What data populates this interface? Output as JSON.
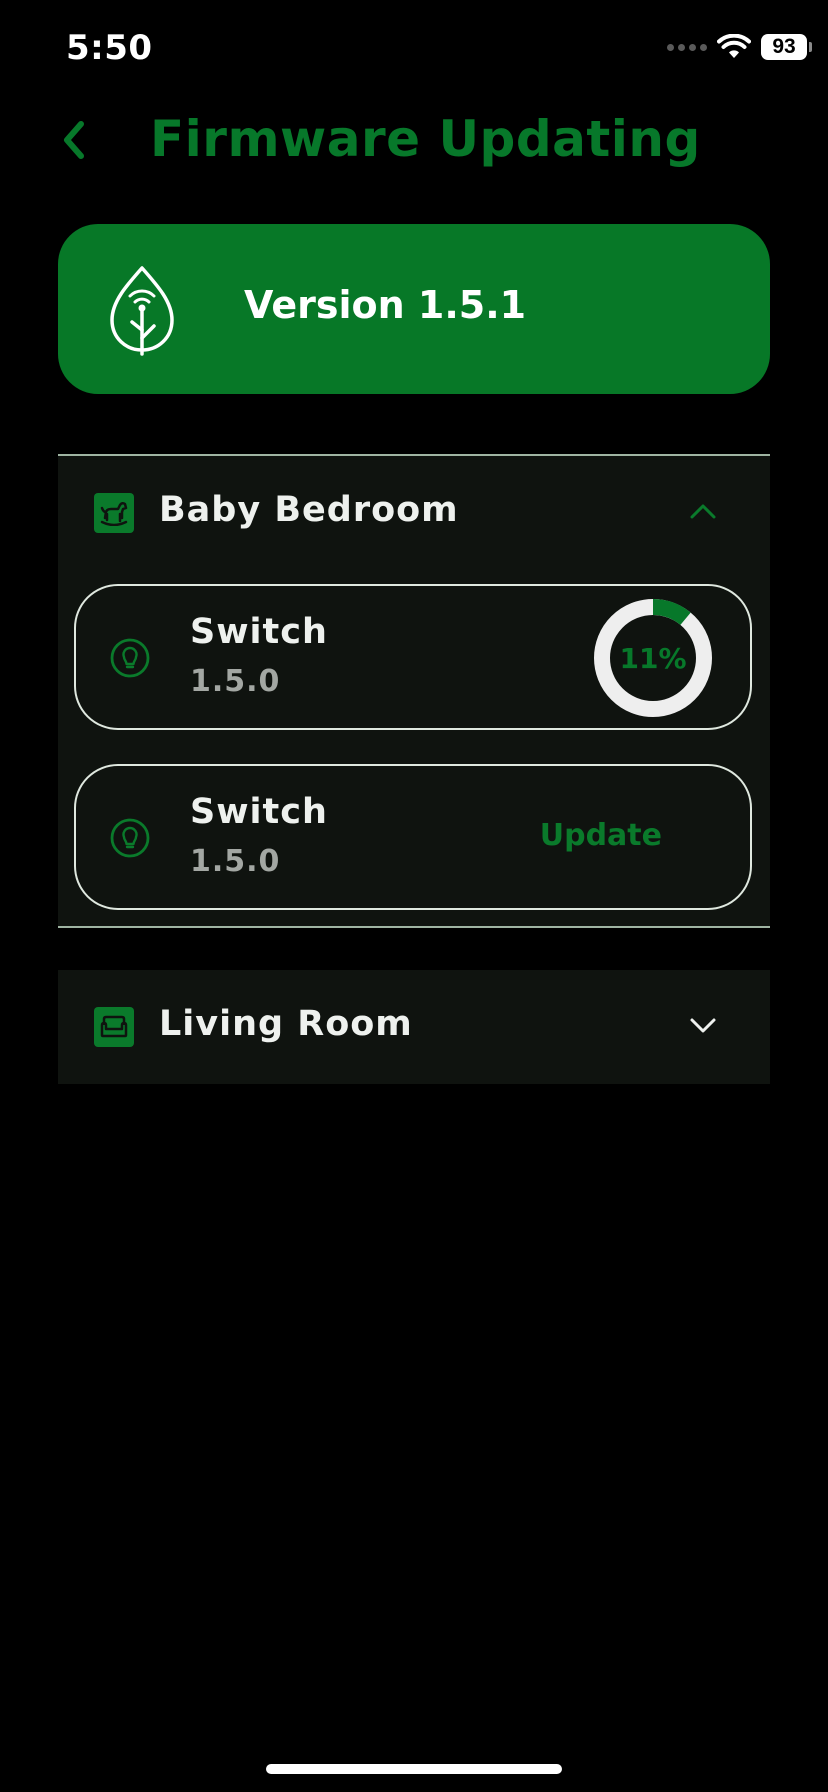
{
  "status_bar": {
    "time": "5:50",
    "battery": "93"
  },
  "header": {
    "title": "Firmware Updating",
    "back_icon": "chevron-left-icon"
  },
  "firmware": {
    "version_label": "Version 1.5.1",
    "icon": "leaf-wifi-icon"
  },
  "rooms": [
    {
      "name": "Baby Bedroom",
      "icon": "rocking-horse-icon",
      "expanded": true,
      "devices": [
        {
          "name": "Switch",
          "version": "1.5.0",
          "icon": "bulb-icon",
          "progress": 11,
          "progress_label": "11%"
        },
        {
          "name": "Switch",
          "version": "1.5.0",
          "icon": "bulb-icon",
          "action_label": "Update"
        }
      ]
    },
    {
      "name": "Living Room",
      "icon": "sofa-icon",
      "expanded": false
    }
  ],
  "colors": {
    "accent": "#077827",
    "background": "#000000",
    "section_bg": "#0f130f",
    "ring_track": "#eeeeee"
  }
}
